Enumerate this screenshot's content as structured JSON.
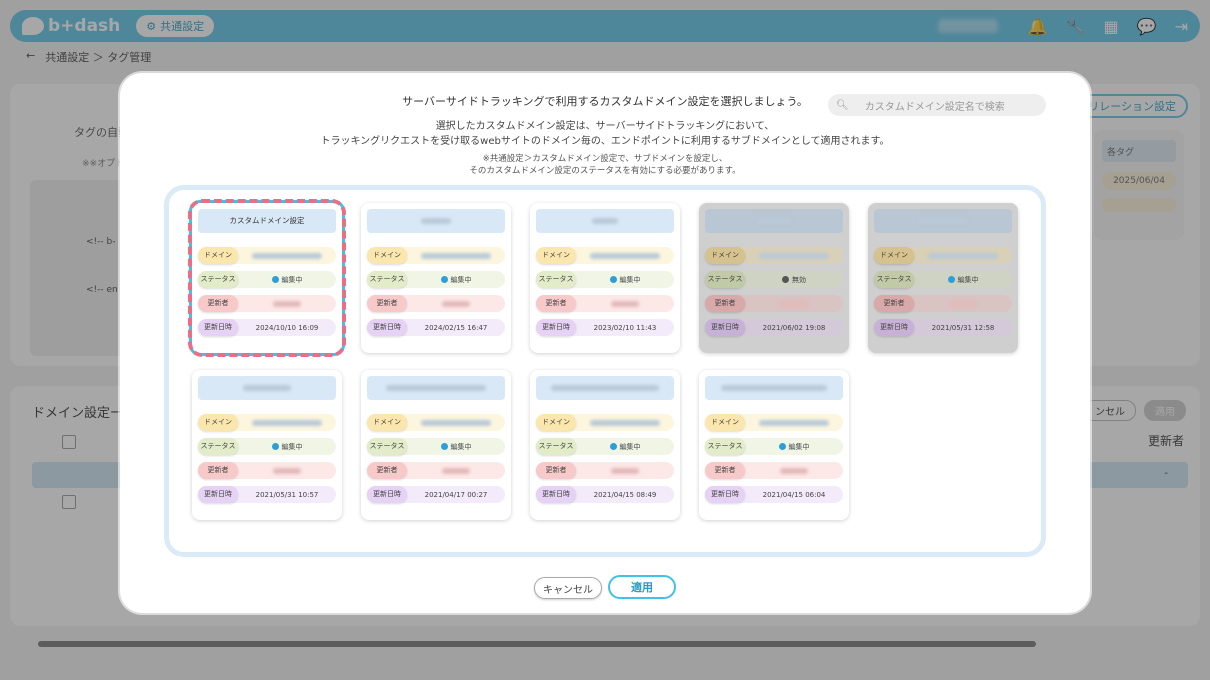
{
  "app": {
    "brand": "b+dash",
    "section_pill": "共通設定",
    "breadcrumb": {
      "back": "←",
      "path": "共通設定 ＞ タグ管理"
    }
  },
  "background": {
    "tag_text": "タグの自動",
    "note_text": "※※オプト",
    "code_lines": [
      "<!-- b-",
      "<!-- en"
    ],
    "relation_button": "リレーション設定",
    "side_card": {
      "header": "各タグ",
      "date": "2025/06/04"
    },
    "bottom_title": "ドメイン設定ー",
    "cancel_short": "ンセル",
    "apply_short": "適用",
    "column_editor": "更新者",
    "row_value": "-"
  },
  "modal": {
    "heading": "サーバーサイドトラッキングで利用するカスタムドメイン設定を選択しましょう。",
    "search_placeholder": "カスタムドメイン設定名で検索",
    "desc_line1": "選択したカスタムドメイン設定は、サーバーサイドトラッキングにおいて、",
    "desc_line2": "トラッキングリクエストを受け取るwebサイトのドメイン毎の、エンドポイントに利用するサブドメインとして適用されます。",
    "note_line1": "※共通設定＞カスタムドメイン設定で、サブドメインを設定し、",
    "note_line2": "そのカスタムドメイン設定のステータスを有効にする必要があります。",
    "labels": {
      "domain": "ドメイン",
      "status": "ステータス",
      "editor": "更新者",
      "date": "更新日時"
    },
    "cancel_label": "キャンセル",
    "apply_label": "適用"
  },
  "cards": [
    {
      "title": "カスタムドメイン設定",
      "status": "編集中",
      "date": "2024/10/10 16:09",
      "selected": true,
      "disabled": false
    },
    {
      "title": "",
      "status": "編集中",
      "date": "2024/02/15 16:47",
      "selected": false,
      "disabled": false
    },
    {
      "title": "",
      "status": "編集中",
      "date": "2023/02/10 11:43",
      "selected": false,
      "disabled": false
    },
    {
      "title": "",
      "status": "無効",
      "date": "2021/06/02 19:08",
      "selected": false,
      "disabled": true
    },
    {
      "title": "",
      "status": "編集中",
      "date": "2021/05/31 12:58",
      "selected": false,
      "disabled": true
    },
    {
      "title": "",
      "status": "編集中",
      "date": "2021/05/31 10:57",
      "selected": false,
      "disabled": false
    },
    {
      "title": "",
      "status": "編集中",
      "date": "2021/04/17 00:27",
      "selected": false,
      "disabled": false
    },
    {
      "title": "",
      "status": "編集中",
      "date": "2021/04/15 08:49",
      "selected": false,
      "disabled": false
    },
    {
      "title": "",
      "status": "編集中",
      "date": "2021/04/15 06:04",
      "selected": false,
      "disabled": false
    }
  ],
  "colors": {
    "accent": "#3fc1e8",
    "highlight": "#ea6f86",
    "topbar": "#5ec4e8"
  }
}
